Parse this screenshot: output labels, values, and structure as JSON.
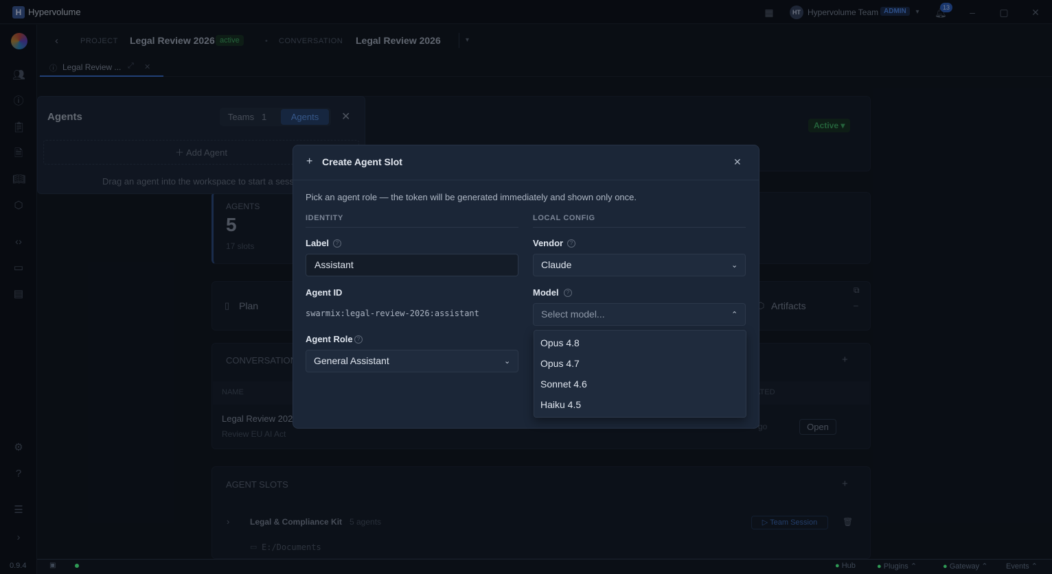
{
  "app": {
    "logo_letter": "H",
    "name": "Hypervolume"
  },
  "titlebar": {
    "avatar_initials": "HT",
    "team": "Hypervolume Team",
    "role_badge": "ADMIN",
    "notifications": "13"
  },
  "header": {
    "project_label": "PROJECT",
    "project_name": "Legal Review 2026",
    "project_status": "active",
    "conversation_label": "CONVERSATION",
    "conversation_name": "Legal Review 2026"
  },
  "tab": {
    "label": "Legal Review ..."
  },
  "agents_panel": {
    "title": "Agents",
    "teams_label": "Teams",
    "teams_count": "1",
    "agents_label": "Agents",
    "add_agent": "Add Agent",
    "hint": "Drag an agent into the workspace to start a sessio"
  },
  "background": {
    "status": "Active",
    "agents_label": "AGENTS",
    "agents_count": "5",
    "slots": "17 slots",
    "plan": "Plan",
    "artifacts": "Artifacts",
    "conversations_label": "CONVERSATION",
    "col_name": "NAME",
    "col_updated": "ATED",
    "row_name": "Legal Review 202",
    "row_desc": "Review EU AI Act",
    "row_time": "go",
    "open_btn": "Open",
    "agent_slots_label": "AGENT SLOTS",
    "kit_name": "Legal & Compliance Kit",
    "kit_count": "5 agents",
    "team_session": "Team Session",
    "path": "E:/Documents"
  },
  "modal": {
    "title": "Create Agent Slot",
    "description": "Pick an agent role — the token will be generated immediately and shown only once.",
    "identity_title": "IDENTITY",
    "local_title": "LOCAL CONFIG",
    "label_label": "Label",
    "label_value": "Assistant",
    "agent_id_label": "Agent ID",
    "agent_id_value": "swarmix:legal-review-2026:assistant",
    "role_label": "Agent Role",
    "role_value": "General Assistant",
    "vendor_label": "Vendor",
    "vendor_value": "Claude",
    "model_label": "Model",
    "model_placeholder": "Select model...",
    "model_options": [
      "Opus 4.8",
      "Opus 4.7",
      "Sonnet 4.6",
      "Haiku 4.5"
    ]
  },
  "statusbar": {
    "version": "0.9.4",
    "hub": "Hub",
    "plugins": "Plugins",
    "gateway": "Gateway",
    "events": "Events"
  }
}
